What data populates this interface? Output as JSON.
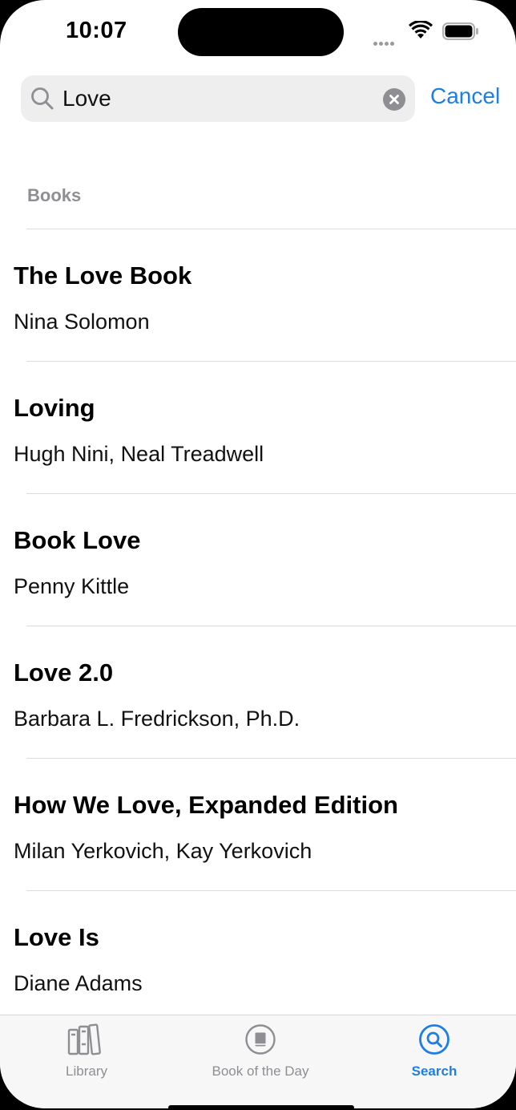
{
  "status_bar": {
    "time": "10:07"
  },
  "search": {
    "query": "Love",
    "cancel_label": "Cancel"
  },
  "section": {
    "header": "Books"
  },
  "results": [
    {
      "title": "The Love Book",
      "author": "Nina Solomon"
    },
    {
      "title": "Loving",
      "author": "Hugh Nini, Neal Treadwell"
    },
    {
      "title": "Book Love",
      "author": "Penny Kittle"
    },
    {
      "title": "Love 2.0",
      "author": "Barbara L. Fredrickson, Ph.D."
    },
    {
      "title": "How We Love, Expanded Edition",
      "author": "Milan Yerkovich, Kay Yerkovich"
    },
    {
      "title": "Love Is",
      "author": "Diane Adams"
    }
  ],
  "tabs": [
    {
      "label": "Library",
      "icon": "library-icon",
      "active": false
    },
    {
      "label": "Book of the Day",
      "icon": "book-of-the-day-icon",
      "active": false
    },
    {
      "label": "Search",
      "icon": "search-icon",
      "active": true
    }
  ],
  "colors": {
    "accent": "#1d7ee6",
    "secondary_text": "#8e8e93",
    "search_field_bg": "#eeeeef"
  }
}
